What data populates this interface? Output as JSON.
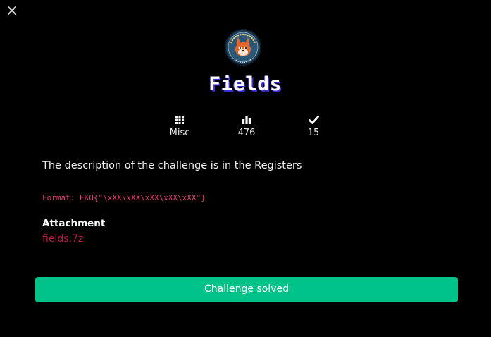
{
  "modal": {
    "close_icon": "close-icon",
    "logo_icon": "event-badge-logo",
    "title": "Fields"
  },
  "stats": [
    {
      "icon": "category-grid-icon",
      "value": "Misc"
    },
    {
      "icon": "bar-chart-icon",
      "value": "476"
    },
    {
      "icon": "check-icon",
      "value": "15"
    }
  ],
  "description": "The description of the challenge is in the Registers",
  "format": "Format: EKO{\"\\xXX\\xXX\\xXX\\xXX\\xXX\"}",
  "attachment": {
    "heading": "Attachment",
    "file": "fields.7z"
  },
  "solved_button": "Challenge solved",
  "colors": {
    "background": "#000000",
    "accent_green": "#00c389",
    "format_pink": "#e83e6c",
    "link_red": "#b01e3c"
  }
}
